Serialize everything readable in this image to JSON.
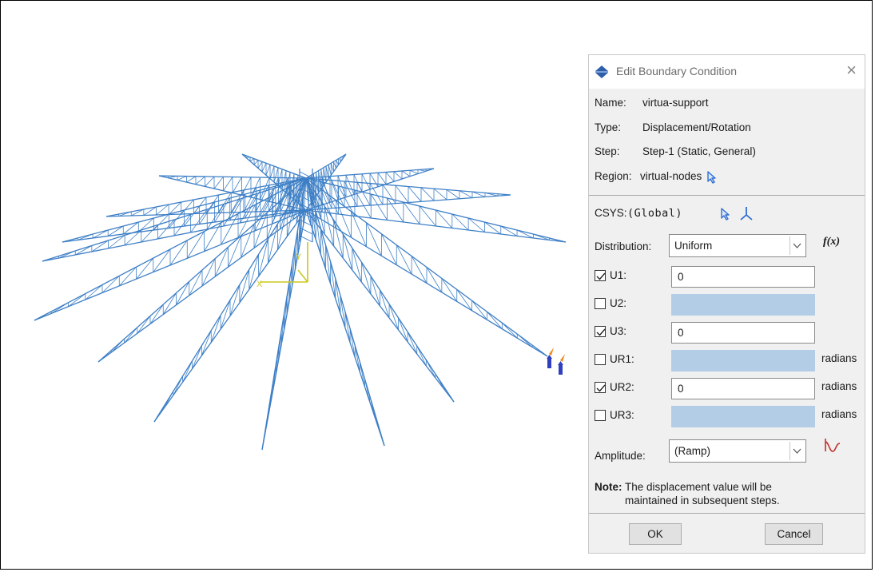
{
  "dialog": {
    "title": "Edit Boundary Condition",
    "close_glyph": "×",
    "name_label": "Name:",
    "name_value": "virtua-support",
    "type_label": "Type:",
    "type_value": "Displacement/Rotation",
    "step_label": "Step:",
    "step_value": "Step-1 (Static, General)",
    "region_label": "Region:",
    "region_value": "virtual-nodes",
    "csys_label": "CSYS:",
    "csys_value": "(Global)",
    "distribution_label": "Distribution:",
    "distribution_value": "Uniform",
    "fx_label": "f(x)",
    "dofs": [
      {
        "label": "U1:",
        "checked": true,
        "value": "0",
        "unit": ""
      },
      {
        "label": "U2:",
        "checked": false,
        "value": "",
        "unit": ""
      },
      {
        "label": "U3:",
        "checked": true,
        "value": "0",
        "unit": ""
      },
      {
        "label": "UR1:",
        "checked": false,
        "value": "",
        "unit": "radians"
      },
      {
        "label": "UR2:",
        "checked": true,
        "value": "0",
        "unit": "radians"
      },
      {
        "label": "UR3:",
        "checked": false,
        "value": "",
        "unit": "radians"
      }
    ],
    "amplitude_label": "Amplitude:",
    "amplitude_value": "(Ramp)",
    "note_label": "Note:",
    "note_line1": "The displacement value will be",
    "note_line2": "maintained in subsequent steps.",
    "ok_label": "OK",
    "cancel_label": "Cancel"
  },
  "viewport": {
    "axis_x_label": "X",
    "axis_y_label": "Y",
    "model_color": "#3d7fc6",
    "axis_color": "#c8c820",
    "bc_colors": [
      "#f08a1c",
      "#2f3fbf"
    ]
  }
}
